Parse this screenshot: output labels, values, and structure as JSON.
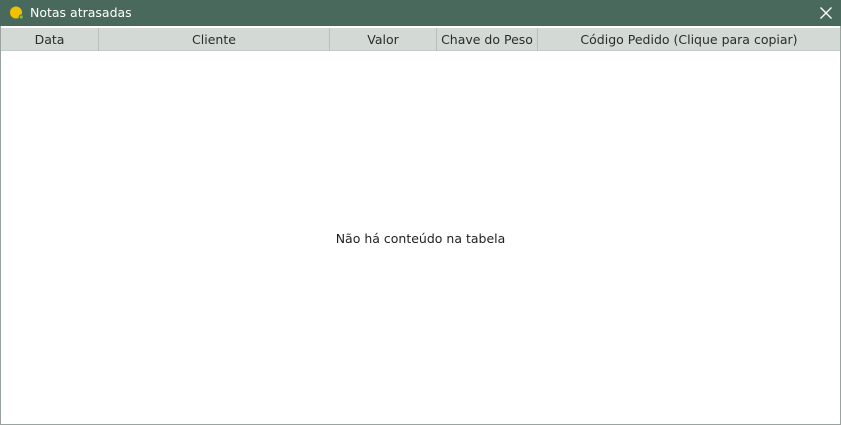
{
  "window": {
    "title": "Notas atrasadas",
    "icon": "yellow-circle-icon",
    "close_icon": "close-icon",
    "titlebar_color": "#49695c",
    "header_color": "#d3dad5"
  },
  "table": {
    "columns": [
      {
        "label": "Data"
      },
      {
        "label": "Cliente"
      },
      {
        "label": "Valor"
      },
      {
        "label": "Chave do Peso"
      },
      {
        "label": "Código Pedido (Clique para copiar)"
      }
    ],
    "rows": [],
    "empty_message": "Não há conteúdo na tabela"
  }
}
